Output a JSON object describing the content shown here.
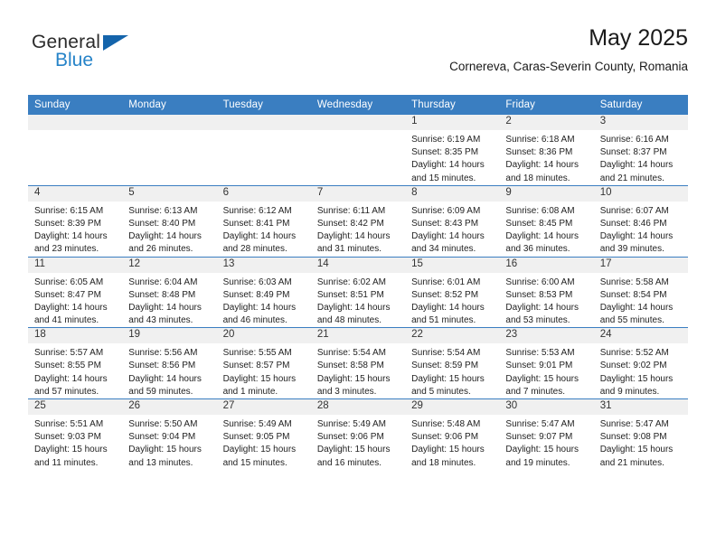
{
  "brand": {
    "name_part1": "General",
    "name_part2": "Blue",
    "triangle_color": "#1464ab",
    "blue_color": "#2683c8"
  },
  "header": {
    "title": "May 2025",
    "subtitle": "Cornereva, Caras-Severin County, Romania"
  },
  "theme": {
    "header_bg": "#3a7ec1",
    "header_text": "#ffffff",
    "daynum_bg": "#f0f0f0",
    "cell_text": "#222222"
  },
  "weekdays": [
    "Sunday",
    "Monday",
    "Tuesday",
    "Wednesday",
    "Thursday",
    "Friday",
    "Saturday"
  ],
  "weeks": [
    [
      {
        "day": "",
        "sunrise": "",
        "sunset": "",
        "daylight1": "",
        "daylight2": "",
        "empty": true
      },
      {
        "day": "",
        "sunrise": "",
        "sunset": "",
        "daylight1": "",
        "daylight2": "",
        "empty": true
      },
      {
        "day": "",
        "sunrise": "",
        "sunset": "",
        "daylight1": "",
        "daylight2": "",
        "empty": true
      },
      {
        "day": "",
        "sunrise": "",
        "sunset": "",
        "daylight1": "",
        "daylight2": "",
        "empty": true
      },
      {
        "day": "1",
        "sunrise": "Sunrise: 6:19 AM",
        "sunset": "Sunset: 8:35 PM",
        "daylight1": "Daylight: 14 hours",
        "daylight2": "and 15 minutes."
      },
      {
        "day": "2",
        "sunrise": "Sunrise: 6:18 AM",
        "sunset": "Sunset: 8:36 PM",
        "daylight1": "Daylight: 14 hours",
        "daylight2": "and 18 minutes."
      },
      {
        "day": "3",
        "sunrise": "Sunrise: 6:16 AM",
        "sunset": "Sunset: 8:37 PM",
        "daylight1": "Daylight: 14 hours",
        "daylight2": "and 21 minutes."
      }
    ],
    [
      {
        "day": "4",
        "sunrise": "Sunrise: 6:15 AM",
        "sunset": "Sunset: 8:39 PM",
        "daylight1": "Daylight: 14 hours",
        "daylight2": "and 23 minutes."
      },
      {
        "day": "5",
        "sunrise": "Sunrise: 6:13 AM",
        "sunset": "Sunset: 8:40 PM",
        "daylight1": "Daylight: 14 hours",
        "daylight2": "and 26 minutes."
      },
      {
        "day": "6",
        "sunrise": "Sunrise: 6:12 AM",
        "sunset": "Sunset: 8:41 PM",
        "daylight1": "Daylight: 14 hours",
        "daylight2": "and 28 minutes."
      },
      {
        "day": "7",
        "sunrise": "Sunrise: 6:11 AM",
        "sunset": "Sunset: 8:42 PM",
        "daylight1": "Daylight: 14 hours",
        "daylight2": "and 31 minutes."
      },
      {
        "day": "8",
        "sunrise": "Sunrise: 6:09 AM",
        "sunset": "Sunset: 8:43 PM",
        "daylight1": "Daylight: 14 hours",
        "daylight2": "and 34 minutes."
      },
      {
        "day": "9",
        "sunrise": "Sunrise: 6:08 AM",
        "sunset": "Sunset: 8:45 PM",
        "daylight1": "Daylight: 14 hours",
        "daylight2": "and 36 minutes."
      },
      {
        "day": "10",
        "sunrise": "Sunrise: 6:07 AM",
        "sunset": "Sunset: 8:46 PM",
        "daylight1": "Daylight: 14 hours",
        "daylight2": "and 39 minutes."
      }
    ],
    [
      {
        "day": "11",
        "sunrise": "Sunrise: 6:05 AM",
        "sunset": "Sunset: 8:47 PM",
        "daylight1": "Daylight: 14 hours",
        "daylight2": "and 41 minutes."
      },
      {
        "day": "12",
        "sunrise": "Sunrise: 6:04 AM",
        "sunset": "Sunset: 8:48 PM",
        "daylight1": "Daylight: 14 hours",
        "daylight2": "and 43 minutes."
      },
      {
        "day": "13",
        "sunrise": "Sunrise: 6:03 AM",
        "sunset": "Sunset: 8:49 PM",
        "daylight1": "Daylight: 14 hours",
        "daylight2": "and 46 minutes."
      },
      {
        "day": "14",
        "sunrise": "Sunrise: 6:02 AM",
        "sunset": "Sunset: 8:51 PM",
        "daylight1": "Daylight: 14 hours",
        "daylight2": "and 48 minutes."
      },
      {
        "day": "15",
        "sunrise": "Sunrise: 6:01 AM",
        "sunset": "Sunset: 8:52 PM",
        "daylight1": "Daylight: 14 hours",
        "daylight2": "and 51 minutes."
      },
      {
        "day": "16",
        "sunrise": "Sunrise: 6:00 AM",
        "sunset": "Sunset: 8:53 PM",
        "daylight1": "Daylight: 14 hours",
        "daylight2": "and 53 minutes."
      },
      {
        "day": "17",
        "sunrise": "Sunrise: 5:58 AM",
        "sunset": "Sunset: 8:54 PM",
        "daylight1": "Daylight: 14 hours",
        "daylight2": "and 55 minutes."
      }
    ],
    [
      {
        "day": "18",
        "sunrise": "Sunrise: 5:57 AM",
        "sunset": "Sunset: 8:55 PM",
        "daylight1": "Daylight: 14 hours",
        "daylight2": "and 57 minutes."
      },
      {
        "day": "19",
        "sunrise": "Sunrise: 5:56 AM",
        "sunset": "Sunset: 8:56 PM",
        "daylight1": "Daylight: 14 hours",
        "daylight2": "and 59 minutes."
      },
      {
        "day": "20",
        "sunrise": "Sunrise: 5:55 AM",
        "sunset": "Sunset: 8:57 PM",
        "daylight1": "Daylight: 15 hours",
        "daylight2": "and 1 minute."
      },
      {
        "day": "21",
        "sunrise": "Sunrise: 5:54 AM",
        "sunset": "Sunset: 8:58 PM",
        "daylight1": "Daylight: 15 hours",
        "daylight2": "and 3 minutes."
      },
      {
        "day": "22",
        "sunrise": "Sunrise: 5:54 AM",
        "sunset": "Sunset: 8:59 PM",
        "daylight1": "Daylight: 15 hours",
        "daylight2": "and 5 minutes."
      },
      {
        "day": "23",
        "sunrise": "Sunrise: 5:53 AM",
        "sunset": "Sunset: 9:01 PM",
        "daylight1": "Daylight: 15 hours",
        "daylight2": "and 7 minutes."
      },
      {
        "day": "24",
        "sunrise": "Sunrise: 5:52 AM",
        "sunset": "Sunset: 9:02 PM",
        "daylight1": "Daylight: 15 hours",
        "daylight2": "and 9 minutes."
      }
    ],
    [
      {
        "day": "25",
        "sunrise": "Sunrise: 5:51 AM",
        "sunset": "Sunset: 9:03 PM",
        "daylight1": "Daylight: 15 hours",
        "daylight2": "and 11 minutes."
      },
      {
        "day": "26",
        "sunrise": "Sunrise: 5:50 AM",
        "sunset": "Sunset: 9:04 PM",
        "daylight1": "Daylight: 15 hours",
        "daylight2": "and 13 minutes."
      },
      {
        "day": "27",
        "sunrise": "Sunrise: 5:49 AM",
        "sunset": "Sunset: 9:05 PM",
        "daylight1": "Daylight: 15 hours",
        "daylight2": "and 15 minutes."
      },
      {
        "day": "28",
        "sunrise": "Sunrise: 5:49 AM",
        "sunset": "Sunset: 9:06 PM",
        "daylight1": "Daylight: 15 hours",
        "daylight2": "and 16 minutes."
      },
      {
        "day": "29",
        "sunrise": "Sunrise: 5:48 AM",
        "sunset": "Sunset: 9:06 PM",
        "daylight1": "Daylight: 15 hours",
        "daylight2": "and 18 minutes."
      },
      {
        "day": "30",
        "sunrise": "Sunrise: 5:47 AM",
        "sunset": "Sunset: 9:07 PM",
        "daylight1": "Daylight: 15 hours",
        "daylight2": "and 19 minutes."
      },
      {
        "day": "31",
        "sunrise": "Sunrise: 5:47 AM",
        "sunset": "Sunset: 9:08 PM",
        "daylight1": "Daylight: 15 hours",
        "daylight2": "and 21 minutes."
      }
    ]
  ]
}
